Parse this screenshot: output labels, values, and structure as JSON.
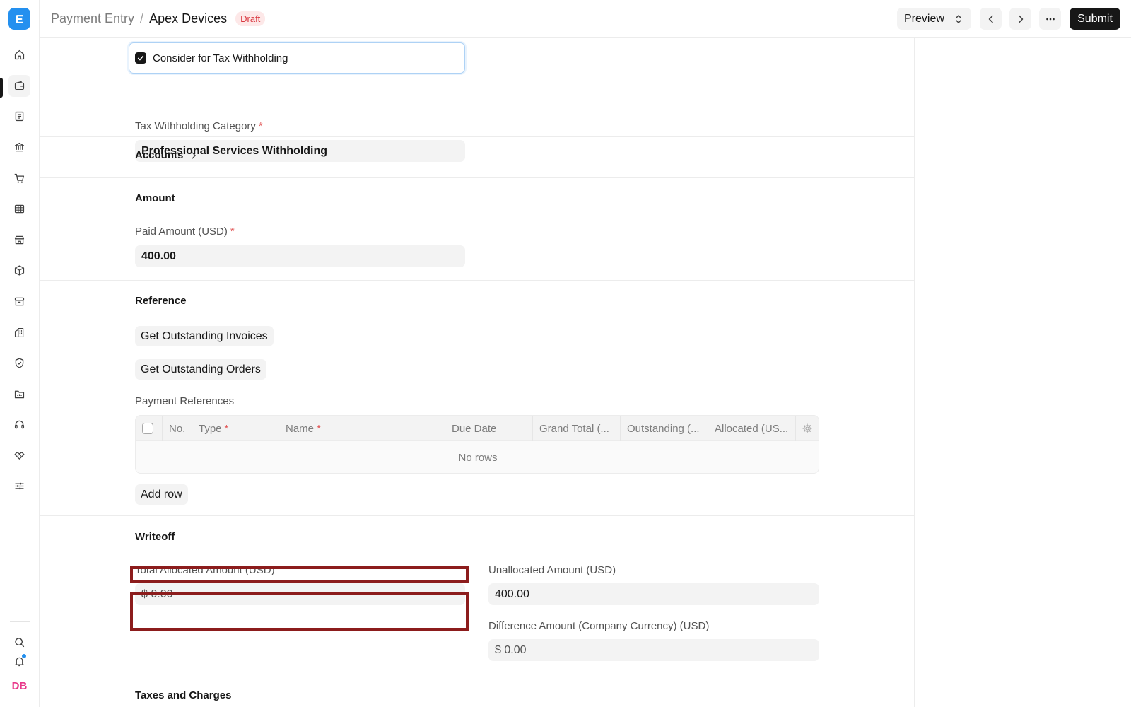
{
  "sidebar": {
    "logo_letter": "E",
    "items": [
      {
        "name": "home-icon"
      },
      {
        "name": "wallet-icon",
        "active": true
      },
      {
        "name": "document-icon"
      },
      {
        "name": "bank-icon"
      },
      {
        "name": "cart-icon"
      },
      {
        "name": "table-icon"
      },
      {
        "name": "store-icon"
      },
      {
        "name": "package-icon"
      },
      {
        "name": "archive-icon"
      },
      {
        "name": "building-icon"
      },
      {
        "name": "shield-icon"
      },
      {
        "name": "folder-icon"
      },
      {
        "name": "headset-icon"
      },
      {
        "name": "handshake-icon"
      },
      {
        "name": "sliders-icon"
      }
    ],
    "avatar_initials": "DB"
  },
  "header": {
    "breadcrumb_parent": "Payment Entry",
    "breadcrumb_separator": "/",
    "title": "Apex Devices",
    "status": "Draft",
    "preview_label": "Preview",
    "submit_label": "Submit"
  },
  "form": {
    "tax_withholding_checkbox": {
      "label": "Consider for Tax Withholding",
      "checked": true
    },
    "tax_withholding_category": {
      "label": "Tax Withholding Category",
      "value": "Professional Services Withholding"
    },
    "accounts_section": "Accounts",
    "amount_section": "Amount",
    "paid_amount": {
      "label": "Paid Amount (USD)",
      "value": "400.00"
    },
    "reference_section": "Reference",
    "get_outstanding_invoices": "Get Outstanding Invoices",
    "get_outstanding_orders": "Get Outstanding Orders",
    "payment_references": {
      "label": "Payment References",
      "columns": [
        "No.",
        "Type",
        "Name",
        "Due Date",
        "Grand Total (...",
        "Outstanding (...",
        "Allocated (US..."
      ],
      "empty_text": "No rows",
      "add_row": "Add row"
    },
    "writeoff_section": "Writeoff",
    "total_allocated": {
      "label": "Total Allocated Amount (USD)",
      "value": "$ 0.00"
    },
    "unallocated": {
      "label": "Unallocated Amount (USD)",
      "value": "400.00"
    },
    "difference": {
      "label": "Difference Amount (Company Currency) (USD)",
      "value": "$ 0.00"
    },
    "taxes_section": "Taxes and Charges"
  },
  "colors": {
    "accent": "#2490ef",
    "highlight": "#8c1c1c",
    "draft_bg": "#fde8e8",
    "draft_text": "#d9363e"
  }
}
